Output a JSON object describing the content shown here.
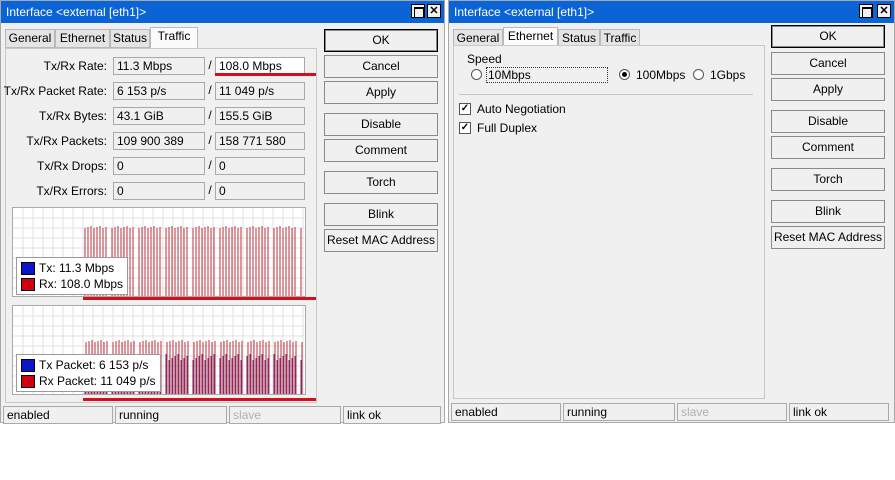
{
  "left_window": {
    "title": "Interface <external [eth1]>",
    "tabs": [
      "General",
      "Ethernet",
      "Status",
      "Traffic"
    ],
    "active_tab": "Traffic",
    "rows": [
      {
        "label": "Tx/Rx Rate:",
        "tx": "11.3 Mbps",
        "rx": "108.0 Mbps"
      },
      {
        "label": "Tx/Rx Packet Rate:",
        "tx": "6 153 p/s",
        "rx": "11 049 p/s"
      },
      {
        "label": "Tx/Rx Bytes:",
        "tx": "43.1 GiB",
        "rx": "155.5 GiB"
      },
      {
        "label": "Tx/Rx Packets:",
        "tx": "109 900 389",
        "rx": "158 771 580"
      },
      {
        "label": "Tx/Rx Drops:",
        "tx": "0",
        "rx": "0"
      },
      {
        "label": "Tx/Rx Errors:",
        "tx": "0",
        "rx": "0"
      }
    ],
    "separator": "/",
    "rate_chart_legend": {
      "tx_label": "Tx:",
      "tx_value": "11.3 Mbps",
      "rx_label": "Rx:",
      "rx_value": "108.0 Mbps"
    },
    "packet_chart_legend": {
      "tx_label": "Tx Packet:",
      "tx_value": "6 153 p/s",
      "rx_label": "Rx Packet:",
      "rx_value": "11 049 p/s"
    },
    "buttons": [
      "OK",
      "Cancel",
      "Apply",
      "Disable",
      "Comment",
      "Torch",
      "Blink",
      "Reset MAC Address"
    ],
    "status": [
      "enabled",
      "running",
      "slave",
      "link ok"
    ]
  },
  "right_window": {
    "title": "Interface <external [eth1]>",
    "tabs": [
      "General",
      "Ethernet",
      "Status",
      "Traffic"
    ],
    "active_tab": "Ethernet",
    "speed_group": "Speed",
    "speed_options": [
      "10Mbps",
      "100Mbps",
      "1Gbps"
    ],
    "speed_selected": "100Mbps",
    "auto_negotiation": "Auto Negotiation",
    "full_duplex": "Full Duplex",
    "buttons": [
      "OK",
      "Cancel",
      "Apply",
      "Disable",
      "Comment",
      "Torch",
      "Blink",
      "Reset MAC Address"
    ],
    "status": [
      "enabled",
      "running",
      "slave",
      "link ok"
    ]
  },
  "colors": {
    "titlebar": "#0a64d6",
    "tx": "#0a14c8",
    "rx": "#d00010",
    "rx_bar": "#b83038",
    "packet_bar": "#6a1e6e",
    "highlight_line": "#d0101a"
  },
  "chart_data": [
    {
      "type": "bar",
      "series": [
        {
          "name": "Tx",
          "current": "11.3 Mbps"
        },
        {
          "name": "Rx",
          "current": "108.0 Mbps"
        }
      ]
    },
    {
      "type": "bar",
      "series": [
        {
          "name": "Tx Packet",
          "current": "6 153 p/s"
        },
        {
          "name": "Rx Packet",
          "current": "11 049 p/s"
        }
      ]
    }
  ]
}
